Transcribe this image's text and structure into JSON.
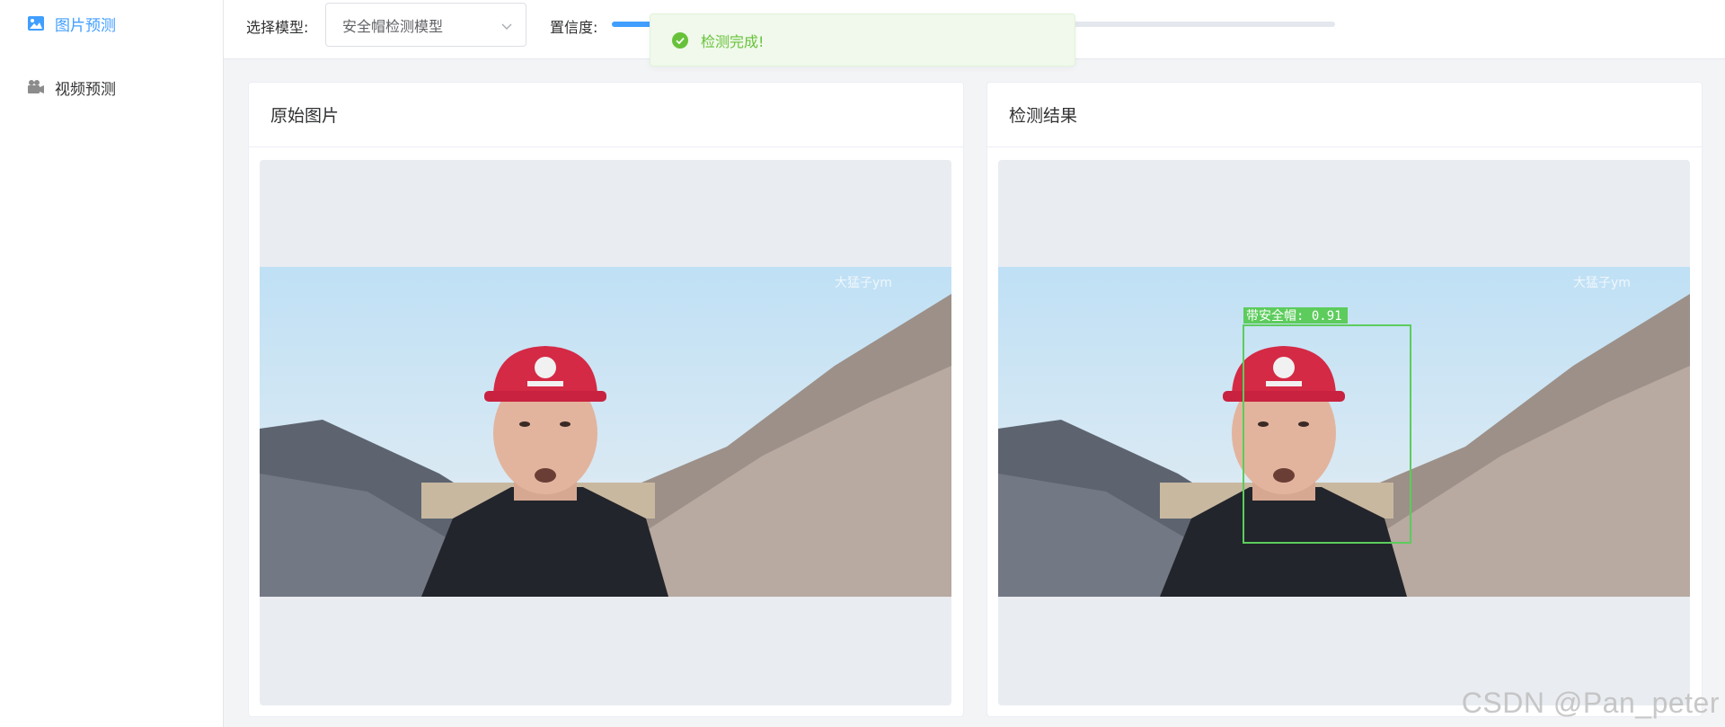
{
  "sidebar": {
    "items": [
      {
        "label": "图片预测",
        "icon": "image-icon",
        "active": true
      },
      {
        "label": "视频预测",
        "icon": "video-camera-icon",
        "active": false
      }
    ]
  },
  "toolbar": {
    "model_label": "选择模型:",
    "model_value": "安全帽检测模型",
    "confidence_label": "置信度:",
    "confidence_value": 0.5
  },
  "toast": {
    "message": "检测完成!",
    "type": "success",
    "icon": "check-circle-icon"
  },
  "panels": {
    "original": {
      "title": "原始图片"
    },
    "result": {
      "title": "检测结果"
    }
  },
  "image": {
    "watermark_text": "大猛子ym",
    "detection": {
      "label": "带安全帽: 0.91"
    }
  },
  "page_watermark": "CSDN @Pan_peter",
  "colors": {
    "accent": "#409eff",
    "success": "#67c23a",
    "detect_box": "#5ccc5c"
  }
}
